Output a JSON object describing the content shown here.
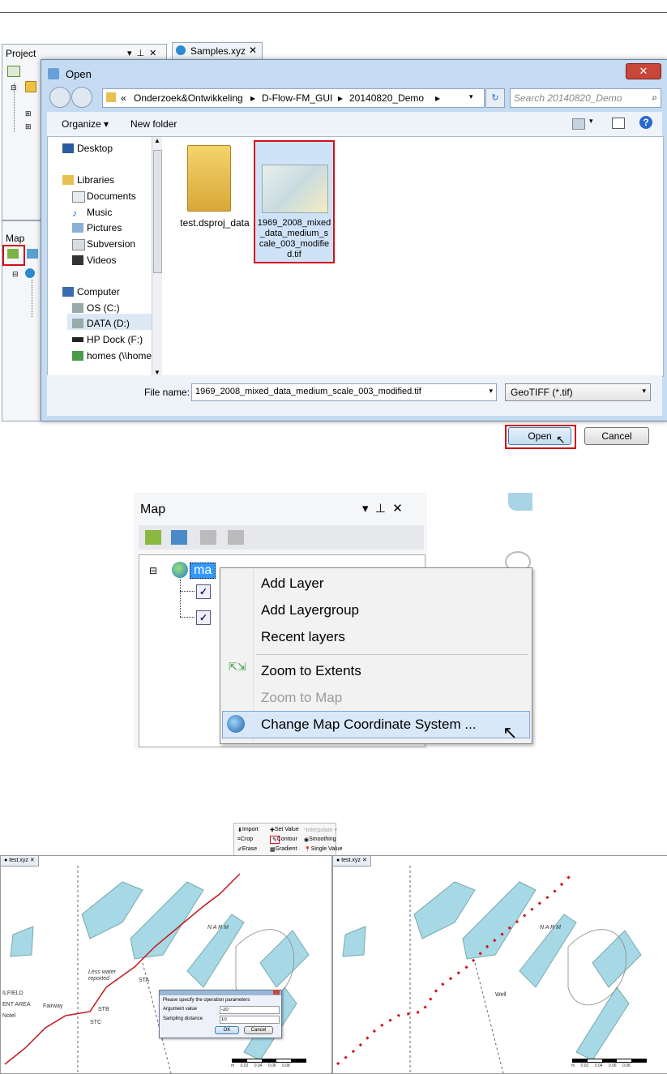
{
  "section1": {
    "project_panel": {
      "title": "Project"
    },
    "tab": {
      "label": "Samples.xyz"
    },
    "map_panel": {
      "title": "Map"
    },
    "dialog": {
      "title": "Open",
      "close_label": "✕",
      "address": [
        "«",
        "Onderzoek&Ontwikkeling",
        "▸",
        "D-Flow-FM_GUI",
        "▸",
        "20140820_Demo",
        "▸"
      ],
      "search_placeholder": "Search 20140820_Demo",
      "organize_label": "Organize ▾",
      "new_folder_label": "New folder",
      "nav": {
        "desktop": "Desktop",
        "libraries": "Libraries",
        "documents": "Documents",
        "music": "Music",
        "pictures": "Pictures",
        "subversion": "Subversion",
        "videos": "Videos",
        "computer": "Computer",
        "os_c": "OS (C:)",
        "data_d": "DATA (D:)",
        "hp_dock": "HP Dock (F:)",
        "homes": "homes (\\\\home"
      },
      "files": [
        {
          "name": "test.dsproj_data"
        },
        {
          "name": "1969_2008_mixed_data_medium_scale_003_modified.tif"
        }
      ],
      "file_label_lines": [
        "1969_2008_mixed",
        "_data_medium_s",
        "cale_003_modifie",
        "d.tif"
      ],
      "file_name_label": "File name:",
      "file_name_value": "1969_2008_mixed_data_medium_scale_003_modified.tif",
      "file_type": "GeoTIFF (*.tif)",
      "open_label": "Open",
      "cancel_label": "Cancel"
    }
  },
  "section2": {
    "title": "Map",
    "layer_root": "ma",
    "menu_items": [
      "Add Layer",
      "Add Layergroup",
      "Recent layers",
      "Zoom to Extents",
      "Zoom to Map",
      "Change Map Coordinate System ..."
    ]
  },
  "section3": {
    "ribbon": {
      "import": "Import",
      "set_value": "Set Value",
      "interpolate": "Interpolate ▾",
      "crop": "Crop",
      "contour": "Contour",
      "smoothing": "Smoothing",
      "erase": "Erase",
      "gradient": "Gradient",
      "single_value": "Single Value"
    },
    "left_tab": "test.xyz",
    "right_tab": "test.xyz",
    "map_labels": {
      "narm": "N A R M",
      "less_water": "Less water",
      "reported": "reported",
      "ilfield": "ILFIELD",
      "ent_area": "ENT AREA",
      "notel": "Notel",
      "fairway": "Fairway",
      "sta": "STA",
      "stb": "STB",
      "stc": "STC",
      "well": "Well"
    },
    "scale_labels": [
      "m",
      "0.02",
      "0.04",
      "0.06",
      "0.08"
    ],
    "param_dialog": {
      "prompt": "Please specify the operation parameters",
      "arg_label": "Argument value",
      "arg_value": "-20",
      "sampling_label": "Sampling distance",
      "sampling_value": "10",
      "ok_label": "OK",
      "cancel_label": "Cancel"
    }
  }
}
